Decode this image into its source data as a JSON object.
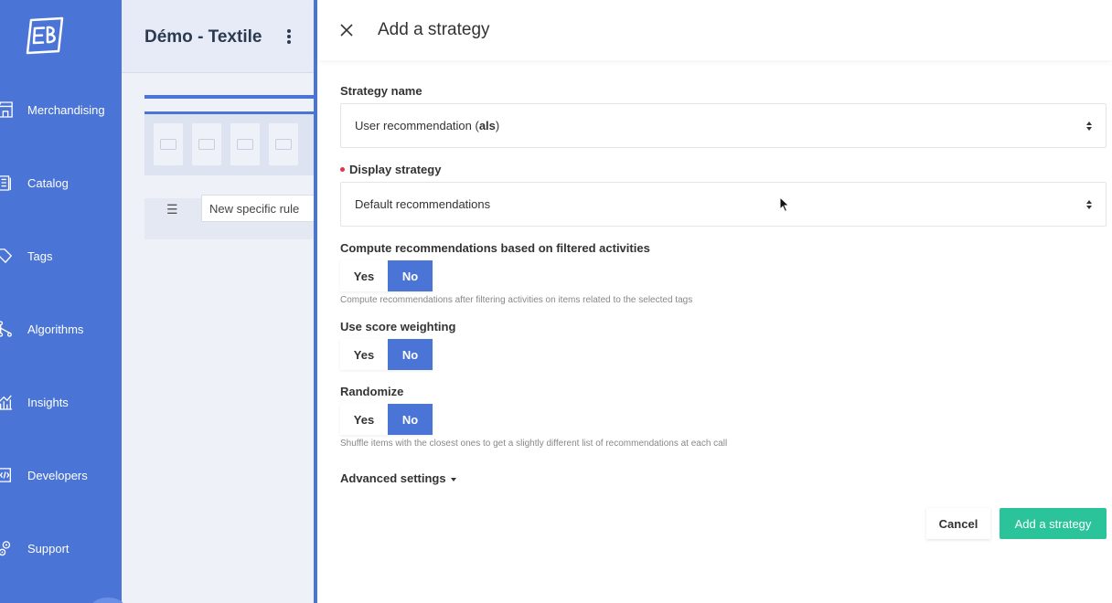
{
  "sidebar": {
    "items": [
      {
        "label": "Merchandising",
        "icon": "storefront-icon"
      },
      {
        "label": "Catalog",
        "icon": "catalog-icon"
      },
      {
        "label": "Tags",
        "icon": "tag-icon"
      },
      {
        "label": "Algorithms",
        "icon": "algorithm-icon"
      },
      {
        "label": "Insights",
        "icon": "chart-icon"
      },
      {
        "label": "Developers",
        "icon": "code-icon"
      },
      {
        "label": "Support",
        "icon": "gears-icon"
      }
    ]
  },
  "background": {
    "title": "Démo - Textile",
    "rule_label": "New specific rule"
  },
  "modal": {
    "title": "Add a strategy",
    "strategy_name": {
      "label": "Strategy name",
      "value_prefix": "User recommendation (",
      "value_bold": "als",
      "value_suffix": ")"
    },
    "display_strategy": {
      "label": "Display strategy",
      "value": "Default recommendations"
    },
    "compute_filtered": {
      "label": "Compute recommendations based on filtered activities",
      "yes": "Yes",
      "no": "No",
      "selected": "No",
      "help": "Compute recommendations after filtering activities on items related to the selected tags"
    },
    "score_weighting": {
      "label": "Use score weighting",
      "yes": "Yes",
      "no": "No",
      "selected": "No"
    },
    "randomize": {
      "label": "Randomize",
      "yes": "Yes",
      "no": "No",
      "selected": "No",
      "help": "Shuffle items with the closest ones to get a slightly different list of recommendations at each call"
    },
    "advanced": "Advanced settings",
    "cancel": "Cancel",
    "submit": "Add a strategy"
  },
  "colors": {
    "sidebar": "#4a74d6",
    "accent": "#4a74d6",
    "primary_button": "#2bc39a",
    "required": "#e0334c"
  }
}
